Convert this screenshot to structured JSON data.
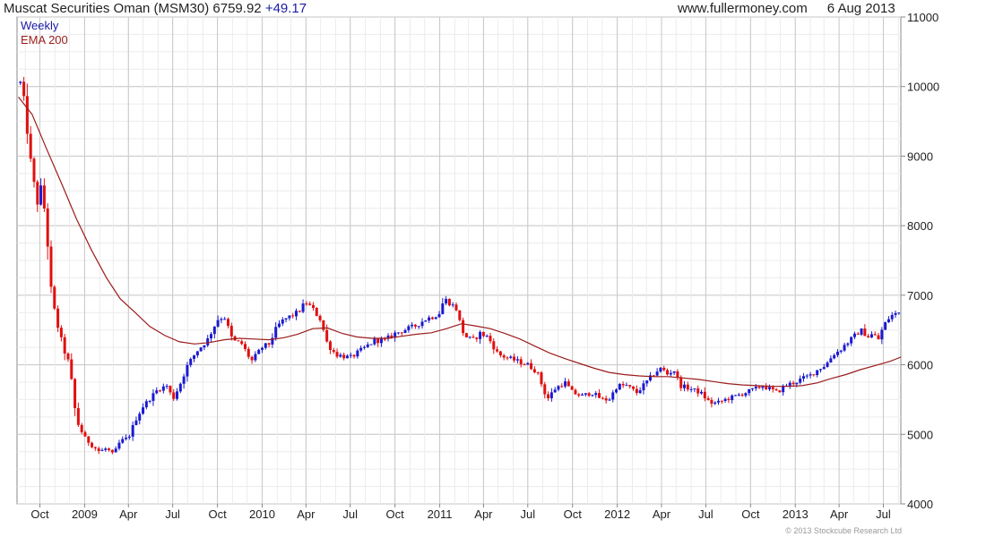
{
  "header": {
    "title": "Muscat Securities Oman (MSM30)",
    "last": "6759.92",
    "change": "+49.17",
    "source": "www.fullermoney.com",
    "date": "6 Aug 2013"
  },
  "footer": {
    "copyright": "© 2013 Stockcube Research Ltd"
  },
  "colors": {
    "up": "#1a1ad0",
    "down": "#e01010",
    "ema": "#9b1b1b",
    "grid": "#d2d2d2",
    "legend_weekly": "#1a1aa6",
    "legend_ema": "#9b1b1b"
  },
  "chart_data": {
    "type": "candlestick",
    "title": "Muscat Securities Oman (MSM30) 6759.92 +49.17",
    "interval": "Weekly",
    "legend": [
      "Weekly",
      "EMA 200"
    ],
    "legend_position": "top-left",
    "grid": true,
    "y_axis": {
      "side": "right",
      "range": [
        4000,
        11000
      ],
      "ticks": [
        4000,
        5000,
        6000,
        7000,
        8000,
        9000,
        10000,
        11000
      ]
    },
    "x_axis": {
      "range": [
        "2008-08-15",
        "2013-08-06"
      ],
      "tick_labels": [
        {
          "date": "2008-10-01",
          "label": "Oct"
        },
        {
          "date": "2009-01-01",
          "label": "2009"
        },
        {
          "date": "2009-04-01",
          "label": "Apr"
        },
        {
          "date": "2009-07-01",
          "label": "Jul"
        },
        {
          "date": "2009-10-01",
          "label": "Oct"
        },
        {
          "date": "2010-01-01",
          "label": "2010"
        },
        {
          "date": "2010-04-01",
          "label": "Apr"
        },
        {
          "date": "2010-07-01",
          "label": "Jul"
        },
        {
          "date": "2010-10-01",
          "label": "Oct"
        },
        {
          "date": "2011-01-01",
          "label": "2011"
        },
        {
          "date": "2011-04-01",
          "label": "Apr"
        },
        {
          "date": "2011-07-01",
          "label": "Jul"
        },
        {
          "date": "2011-10-01",
          "label": "Oct"
        },
        {
          "date": "2012-01-01",
          "label": "2012"
        },
        {
          "date": "2012-04-01",
          "label": "Apr"
        },
        {
          "date": "2012-07-01",
          "label": "Jul"
        },
        {
          "date": "2012-10-01",
          "label": "Oct"
        },
        {
          "date": "2013-01-01",
          "label": "2013"
        },
        {
          "date": "2013-04-01",
          "label": "Apr"
        },
        {
          "date": "2013-07-01",
          "label": "Jul"
        }
      ]
    },
    "close_path": [
      [
        "2008-08-22",
        10050
      ],
      [
        "2008-09-01",
        9700
      ],
      [
        "2008-09-08",
        9100
      ],
      [
        "2008-09-15",
        8800
      ],
      [
        "2008-09-25",
        8300
      ],
      [
        "2008-10-05",
        8600
      ],
      [
        "2008-10-15",
        7900
      ],
      [
        "2008-10-25",
        7000
      ],
      [
        "2008-11-05",
        6600
      ],
      [
        "2008-11-20",
        6200
      ],
      [
        "2008-12-01",
        6000
      ],
      [
        "2008-12-15",
        5200
      ],
      [
        "2009-01-01",
        4950
      ],
      [
        "2009-01-15",
        4850
      ],
      [
        "2009-02-01",
        4750
      ],
      [
        "2009-02-15",
        4800
      ],
      [
        "2009-03-01",
        4700
      ],
      [
        "2009-03-15",
        4900
      ],
      [
        "2009-04-01",
        4950
      ],
      [
        "2009-04-15",
        5200
      ],
      [
        "2009-05-01",
        5400
      ],
      [
        "2009-06-01",
        5650
      ],
      [
        "2009-06-20",
        5700
      ],
      [
        "2009-07-01",
        5500
      ],
      [
        "2009-07-15",
        5700
      ],
      [
        "2009-08-01",
        6000
      ],
      [
        "2009-08-20",
        6200
      ],
      [
        "2009-09-10",
        6350
      ],
      [
        "2009-10-01",
        6650
      ],
      [
        "2009-10-15",
        6700
      ],
      [
        "2009-11-01",
        6350
      ],
      [
        "2009-11-20",
        6300
      ],
      [
        "2009-12-10",
        6050
      ],
      [
        "2010-01-01",
        6250
      ],
      [
        "2010-01-15",
        6300
      ],
      [
        "2010-02-01",
        6550
      ],
      [
        "2010-02-15",
        6650
      ],
      [
        "2010-03-01",
        6700
      ],
      [
        "2010-03-15",
        6750
      ],
      [
        "2010-04-01",
        6900
      ],
      [
        "2010-04-15",
        6800
      ],
      [
        "2010-05-01",
        6650
      ],
      [
        "2010-05-15",
        6300
      ],
      [
        "2010-06-01",
        6150
      ],
      [
        "2010-07-01",
        6100
      ],
      [
        "2010-08-01",
        6250
      ],
      [
        "2010-08-20",
        6350
      ],
      [
        "2010-09-10",
        6350
      ],
      [
        "2010-10-01",
        6450
      ],
      [
        "2010-10-20",
        6500
      ],
      [
        "2010-11-10",
        6550
      ],
      [
        "2010-12-01",
        6650
      ],
      [
        "2010-12-20",
        6700
      ],
      [
        "2011-01-01",
        6750
      ],
      [
        "2011-01-10",
        6950
      ],
      [
        "2011-01-20",
        6900
      ],
      [
        "2011-02-05",
        6800
      ],
      [
        "2011-02-15",
        6500
      ],
      [
        "2011-02-25",
        6400
      ],
      [
        "2011-03-10",
        6350
      ],
      [
        "2011-03-25",
        6450
      ],
      [
        "2011-04-10",
        6400
      ],
      [
        "2011-05-01",
        6150
      ],
      [
        "2011-05-20",
        6100
      ],
      [
        "2011-06-10",
        6050
      ],
      [
        "2011-07-01",
        6000
      ],
      [
        "2011-07-20",
        5900
      ],
      [
        "2011-08-10",
        5500
      ],
      [
        "2011-08-25",
        5650
      ],
      [
        "2011-09-15",
        5750
      ],
      [
        "2011-10-01",
        5600
      ],
      [
        "2011-10-20",
        5550
      ],
      [
        "2011-11-10",
        5600
      ],
      [
        "2011-12-01",
        5500
      ],
      [
        "2011-12-15",
        5500
      ],
      [
        "2012-01-01",
        5700
      ],
      [
        "2012-01-20",
        5700
      ],
      [
        "2012-02-10",
        5600
      ],
      [
        "2012-03-01",
        5750
      ],
      [
        "2012-03-20",
        5900
      ],
      [
        "2012-04-01",
        5950
      ],
      [
        "2012-04-15",
        5850
      ],
      [
        "2012-04-25",
        5950
      ],
      [
        "2012-05-10",
        5700
      ],
      [
        "2012-06-01",
        5650
      ],
      [
        "2012-06-20",
        5600
      ],
      [
        "2012-07-10",
        5450
      ],
      [
        "2012-07-25",
        5450
      ],
      [
        "2012-08-10",
        5500
      ],
      [
        "2012-09-01",
        5550
      ],
      [
        "2012-09-20",
        5600
      ],
      [
        "2012-10-10",
        5650
      ],
      [
        "2012-10-25",
        5700
      ],
      [
        "2012-11-10",
        5650
      ],
      [
        "2012-11-25",
        5600
      ],
      [
        "2012-12-10",
        5700
      ],
      [
        "2013-01-01",
        5750
      ],
      [
        "2013-01-15",
        5800
      ],
      [
        "2013-02-01",
        5850
      ],
      [
        "2013-02-20",
        5950
      ],
      [
        "2013-03-05",
        6000
      ],
      [
        "2013-03-20",
        6150
      ],
      [
        "2013-04-01",
        6200
      ],
      [
        "2013-04-15",
        6300
      ],
      [
        "2013-05-01",
        6400
      ],
      [
        "2013-05-15",
        6500
      ],
      [
        "2013-06-01",
        6400
      ],
      [
        "2013-06-10",
        6450
      ],
      [
        "2013-06-20",
        6350
      ],
      [
        "2013-07-01",
        6550
      ],
      [
        "2013-07-15",
        6700
      ],
      [
        "2013-08-06",
        6760
      ]
    ],
    "ema_path": [
      [
        "2008-08-18",
        9850
      ],
      [
        "2008-09-15",
        9600
      ],
      [
        "2008-10-15",
        9100
      ],
      [
        "2008-11-15",
        8600
      ],
      [
        "2008-12-15",
        8100
      ],
      [
        "2009-01-15",
        7650
      ],
      [
        "2009-02-15",
        7250
      ],
      [
        "2009-03-15",
        6950
      ],
      [
        "2009-04-15",
        6750
      ],
      [
        "2009-05-15",
        6550
      ],
      [
        "2009-06-15",
        6420
      ],
      [
        "2009-07-15",
        6330
      ],
      [
        "2009-08-15",
        6300
      ],
      [
        "2009-09-15",
        6320
      ],
      [
        "2009-10-15",
        6360
      ],
      [
        "2009-11-15",
        6380
      ],
      [
        "2009-12-15",
        6370
      ],
      [
        "2010-01-15",
        6360
      ],
      [
        "2010-02-15",
        6390
      ],
      [
        "2010-03-15",
        6440
      ],
      [
        "2010-04-15",
        6520
      ],
      [
        "2010-05-15",
        6530
      ],
      [
        "2010-06-15",
        6450
      ],
      [
        "2010-07-15",
        6400
      ],
      [
        "2010-08-15",
        6380
      ],
      [
        "2010-09-15",
        6380
      ],
      [
        "2010-10-15",
        6410
      ],
      [
        "2010-11-15",
        6440
      ],
      [
        "2010-12-15",
        6460
      ],
      [
        "2011-01-15",
        6520
      ],
      [
        "2011-02-15",
        6590
      ],
      [
        "2011-03-15",
        6560
      ],
      [
        "2011-04-15",
        6520
      ],
      [
        "2011-05-15",
        6450
      ],
      [
        "2011-06-15",
        6370
      ],
      [
        "2011-07-15",
        6270
      ],
      [
        "2011-08-15",
        6170
      ],
      [
        "2011-09-15",
        6090
      ],
      [
        "2011-10-15",
        6020
      ],
      [
        "2011-11-15",
        5950
      ],
      [
        "2011-12-15",
        5890
      ],
      [
        "2012-01-15",
        5860
      ],
      [
        "2012-02-15",
        5840
      ],
      [
        "2012-03-15",
        5830
      ],
      [
        "2012-04-15",
        5830
      ],
      [
        "2012-05-15",
        5810
      ],
      [
        "2012-06-15",
        5790
      ],
      [
        "2012-07-15",
        5760
      ],
      [
        "2012-08-15",
        5730
      ],
      [
        "2012-09-15",
        5710
      ],
      [
        "2012-10-15",
        5700
      ],
      [
        "2012-11-15",
        5690
      ],
      [
        "2012-12-15",
        5690
      ],
      [
        "2013-01-15",
        5700
      ],
      [
        "2013-02-15",
        5740
      ],
      [
        "2013-03-15",
        5800
      ],
      [
        "2013-04-15",
        5860
      ],
      [
        "2013-05-15",
        5930
      ],
      [
        "2013-06-15",
        5990
      ],
      [
        "2013-07-15",
        6050
      ],
      [
        "2013-08-06",
        6110
      ]
    ]
  }
}
